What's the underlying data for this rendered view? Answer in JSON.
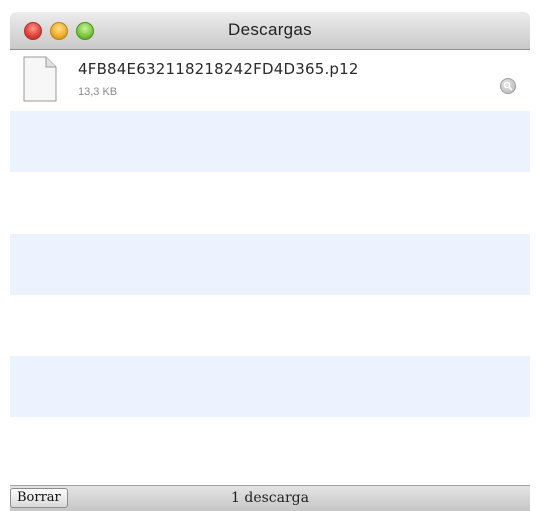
{
  "window": {
    "title": "Descargas"
  },
  "downloads": [
    {
      "file_name": "4FB84E632118218242FD4D365.p12",
      "file_size": "13,3 KB",
      "icon": "document-icon",
      "reveal_icon": "magnifier-icon"
    }
  ],
  "footer": {
    "clear_button": "Borrar",
    "status": "1 descarga"
  },
  "colors": {
    "row_alternate": "#edf3fe",
    "row_default": "#ffffff"
  }
}
